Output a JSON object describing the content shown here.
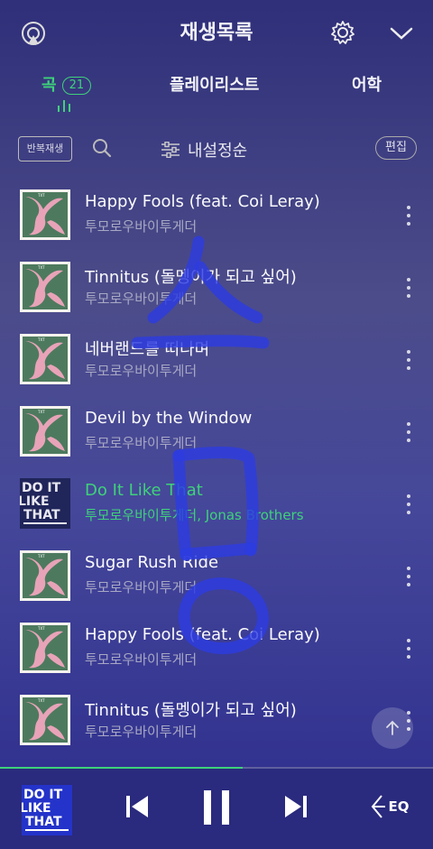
{
  "header": {
    "title": "재생목록"
  },
  "tabs": [
    {
      "label": "곡",
      "count": "21",
      "active": true
    },
    {
      "label": "플레이리스트"
    },
    {
      "label": "어학"
    }
  ],
  "toolbar": {
    "repeat_label": "반복재생",
    "sort_label": "내설정순",
    "edit_label": "편집"
  },
  "tracks": [
    {
      "title": "Happy Fools (feat. Coi Leray)",
      "artist": "투모로우바이투게더",
      "art": "pink"
    },
    {
      "title": "Tinnitus (돌멩이가 되고 싶어)",
      "artist": "투모로우바이투게더",
      "art": "pink"
    },
    {
      "title": "네버랜드를 떠나며",
      "artist": "투모로우바이투게더",
      "art": "pink"
    },
    {
      "title": "Devil by the Window",
      "artist": "투모로우바이투게더",
      "art": "pink"
    },
    {
      "title": "Do It Like That",
      "artist": "투모로우바이투게더, Jonas Brothers",
      "art": "blue",
      "playing": true
    },
    {
      "title": "Sugar Rush Ride",
      "artist": "투모로우바이투게더",
      "art": "pink"
    },
    {
      "title": "Happy Fools (feat. Coi Leray)",
      "artist": "투모로우바이투게더",
      "art": "pink"
    },
    {
      "title": "Tinnitus (돌멩이가 되고 싶어)",
      "artist": "투모로우바이투게더",
      "art": "pink"
    }
  ],
  "player": {
    "progress": 0.56,
    "eq_label": "EQ",
    "art_text": "DO IT LIKE THAT"
  },
  "colors": {
    "accent": "#3ed27a",
    "scrawl": "#2d3ce0"
  }
}
